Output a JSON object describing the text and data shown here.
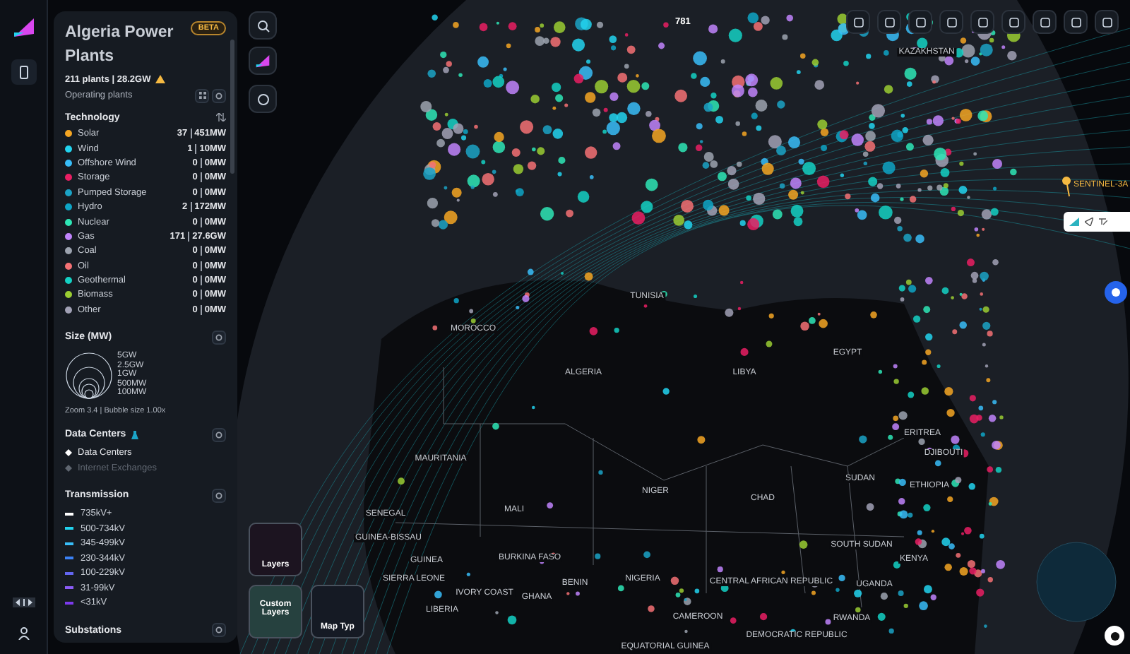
{
  "panel": {
    "title": "Algeria Power Plants",
    "badge": "BETA",
    "summary": "211 plants | 28.2GW",
    "filter": "Operating plants",
    "technology": {
      "title": "Technology",
      "items": [
        {
          "label": "Solar",
          "color": "#f5a623",
          "count": "37",
          "capacity": "451MW"
        },
        {
          "label": "Wind",
          "color": "#22d3ee",
          "count": "1",
          "capacity": "10MW"
        },
        {
          "label": "Offshore Wind",
          "color": "#38bdf8",
          "count": "0",
          "capacity": "0MW"
        },
        {
          "label": "Storage",
          "color": "#e91e63",
          "count": "0",
          "capacity": "0MW"
        },
        {
          "label": "Pumped Storage",
          "color": "#1ba3c6",
          "count": "0",
          "capacity": "0MW"
        },
        {
          "label": "Hydro",
          "color": "#0ea5c6",
          "count": "2",
          "capacity": "172MW"
        },
        {
          "label": "Nuclear",
          "color": "#2ee6b6",
          "count": "0",
          "capacity": "0MW"
        },
        {
          "label": "Gas",
          "color": "#c084fc",
          "count": "171",
          "capacity": "27.6GW"
        },
        {
          "label": "Coal",
          "color": "#9ca3af",
          "count": "0",
          "capacity": "0MW"
        },
        {
          "label": "Oil",
          "color": "#f47174",
          "count": "0",
          "capacity": "0MW"
        },
        {
          "label": "Geothermal",
          "color": "#14d1c4",
          "count": "0",
          "capacity": "0MW"
        },
        {
          "label": "Biomass",
          "color": "#9acd32",
          "count": "0",
          "capacity": "0MW"
        },
        {
          "label": "Other",
          "color": "#a1a1b5",
          "count": "0",
          "capacity": "0MW"
        }
      ]
    },
    "size": {
      "title": "Size (MW)",
      "labels": [
        "5GW",
        "2.5GW",
        "1GW",
        "500MW",
        "100MW"
      ],
      "zoom_info": "Zoom 3.4 | Bubble size 1.00x"
    },
    "data_centers": {
      "title": "Data Centers",
      "items": [
        {
          "label": "Data Centers",
          "on": true
        },
        {
          "label": "Internet Exchanges",
          "on": false
        }
      ]
    },
    "transmission": {
      "title": "Transmission",
      "items": [
        {
          "label": "735kV+",
          "color": "#ffffff"
        },
        {
          "label": "500-734kV",
          "color": "#22d3ee"
        },
        {
          "label": "345-499kV",
          "color": "#38bdf8"
        },
        {
          "label": "230-344kV",
          "color": "#3b82f6"
        },
        {
          "label": "100-229kV",
          "color": "#6366f1"
        },
        {
          "label": "31-99kV",
          "color": "#8b5cf6"
        },
        {
          "label": "<31kV",
          "color": "#7c3aed"
        }
      ]
    },
    "substations": {
      "title": "Substations"
    }
  },
  "map": {
    "count": "781",
    "satellite": "SENTINEL-3A",
    "labels": [
      "KAZAKHSTAN",
      "MOROCCO",
      "TUNISIA",
      "ALGERIA",
      "LIBYA",
      "EGYPT",
      "MAURITANIA",
      "NIGER",
      "CHAD",
      "MALI",
      "SENEGAL",
      "GUINEA-BISSAU",
      "SUDAN",
      "ERITREA",
      "DJIBOUTI",
      "ETHIOPIA",
      "SOUTH SUDAN",
      "GUINEA",
      "BURKINA FASO",
      "SIERRA LEONE",
      "IVORY COAST",
      "GHANA",
      "BENIN",
      "NIGERIA",
      "CENTRAL AFRICAN REPUBLIC",
      "KENYA",
      "UGANDA",
      "LIBERIA",
      "CAMEROON",
      "RWANDA",
      "DEMOCRATIC REPUBLIC",
      "EQUATORIAL GUINEA"
    ],
    "tiles": [
      {
        "label": "Layers",
        "kind": "layers"
      },
      {
        "label": "Custom Layers",
        "kind": "custom"
      },
      {
        "label": "Map Typ",
        "kind": "maptype"
      }
    ]
  }
}
